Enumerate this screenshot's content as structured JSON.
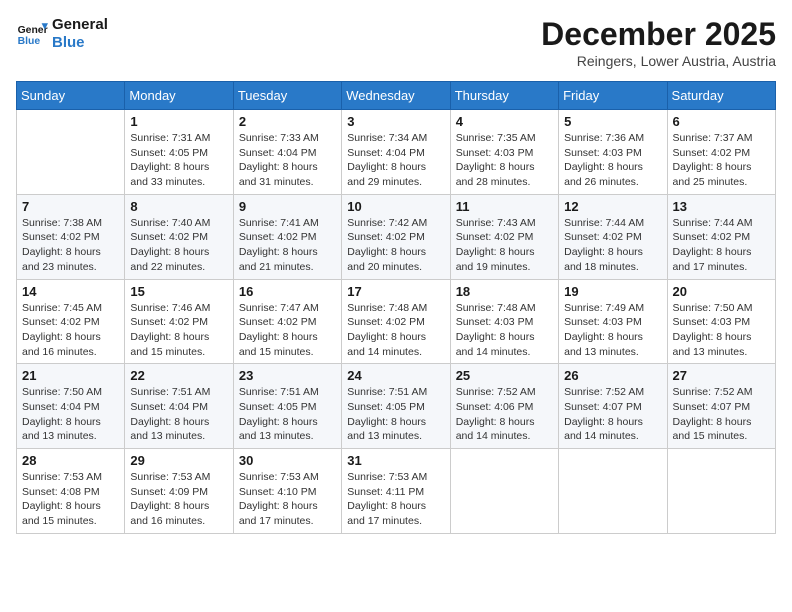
{
  "header": {
    "logo_line1": "General",
    "logo_line2": "Blue",
    "month_title": "December 2025",
    "subtitle": "Reingers, Lower Austria, Austria"
  },
  "weekdays": [
    "Sunday",
    "Monday",
    "Tuesday",
    "Wednesday",
    "Thursday",
    "Friday",
    "Saturday"
  ],
  "weeks": [
    [
      {
        "day": "",
        "info": ""
      },
      {
        "day": "1",
        "info": "Sunrise: 7:31 AM\nSunset: 4:05 PM\nDaylight: 8 hours\nand 33 minutes."
      },
      {
        "day": "2",
        "info": "Sunrise: 7:33 AM\nSunset: 4:04 PM\nDaylight: 8 hours\nand 31 minutes."
      },
      {
        "day": "3",
        "info": "Sunrise: 7:34 AM\nSunset: 4:04 PM\nDaylight: 8 hours\nand 29 minutes."
      },
      {
        "day": "4",
        "info": "Sunrise: 7:35 AM\nSunset: 4:03 PM\nDaylight: 8 hours\nand 28 minutes."
      },
      {
        "day": "5",
        "info": "Sunrise: 7:36 AM\nSunset: 4:03 PM\nDaylight: 8 hours\nand 26 minutes."
      },
      {
        "day": "6",
        "info": "Sunrise: 7:37 AM\nSunset: 4:02 PM\nDaylight: 8 hours\nand 25 minutes."
      }
    ],
    [
      {
        "day": "7",
        "info": "Sunrise: 7:38 AM\nSunset: 4:02 PM\nDaylight: 8 hours\nand 23 minutes."
      },
      {
        "day": "8",
        "info": "Sunrise: 7:40 AM\nSunset: 4:02 PM\nDaylight: 8 hours\nand 22 minutes."
      },
      {
        "day": "9",
        "info": "Sunrise: 7:41 AM\nSunset: 4:02 PM\nDaylight: 8 hours\nand 21 minutes."
      },
      {
        "day": "10",
        "info": "Sunrise: 7:42 AM\nSunset: 4:02 PM\nDaylight: 8 hours\nand 20 minutes."
      },
      {
        "day": "11",
        "info": "Sunrise: 7:43 AM\nSunset: 4:02 PM\nDaylight: 8 hours\nand 19 minutes."
      },
      {
        "day": "12",
        "info": "Sunrise: 7:44 AM\nSunset: 4:02 PM\nDaylight: 8 hours\nand 18 minutes."
      },
      {
        "day": "13",
        "info": "Sunrise: 7:44 AM\nSunset: 4:02 PM\nDaylight: 8 hours\nand 17 minutes."
      }
    ],
    [
      {
        "day": "14",
        "info": "Sunrise: 7:45 AM\nSunset: 4:02 PM\nDaylight: 8 hours\nand 16 minutes."
      },
      {
        "day": "15",
        "info": "Sunrise: 7:46 AM\nSunset: 4:02 PM\nDaylight: 8 hours\nand 15 minutes."
      },
      {
        "day": "16",
        "info": "Sunrise: 7:47 AM\nSunset: 4:02 PM\nDaylight: 8 hours\nand 15 minutes."
      },
      {
        "day": "17",
        "info": "Sunrise: 7:48 AM\nSunset: 4:02 PM\nDaylight: 8 hours\nand 14 minutes."
      },
      {
        "day": "18",
        "info": "Sunrise: 7:48 AM\nSunset: 4:03 PM\nDaylight: 8 hours\nand 14 minutes."
      },
      {
        "day": "19",
        "info": "Sunrise: 7:49 AM\nSunset: 4:03 PM\nDaylight: 8 hours\nand 13 minutes."
      },
      {
        "day": "20",
        "info": "Sunrise: 7:50 AM\nSunset: 4:03 PM\nDaylight: 8 hours\nand 13 minutes."
      }
    ],
    [
      {
        "day": "21",
        "info": "Sunrise: 7:50 AM\nSunset: 4:04 PM\nDaylight: 8 hours\nand 13 minutes."
      },
      {
        "day": "22",
        "info": "Sunrise: 7:51 AM\nSunset: 4:04 PM\nDaylight: 8 hours\nand 13 minutes."
      },
      {
        "day": "23",
        "info": "Sunrise: 7:51 AM\nSunset: 4:05 PM\nDaylight: 8 hours\nand 13 minutes."
      },
      {
        "day": "24",
        "info": "Sunrise: 7:51 AM\nSunset: 4:05 PM\nDaylight: 8 hours\nand 13 minutes."
      },
      {
        "day": "25",
        "info": "Sunrise: 7:52 AM\nSunset: 4:06 PM\nDaylight: 8 hours\nand 14 minutes."
      },
      {
        "day": "26",
        "info": "Sunrise: 7:52 AM\nSunset: 4:07 PM\nDaylight: 8 hours\nand 14 minutes."
      },
      {
        "day": "27",
        "info": "Sunrise: 7:52 AM\nSunset: 4:07 PM\nDaylight: 8 hours\nand 15 minutes."
      }
    ],
    [
      {
        "day": "28",
        "info": "Sunrise: 7:53 AM\nSunset: 4:08 PM\nDaylight: 8 hours\nand 15 minutes."
      },
      {
        "day": "29",
        "info": "Sunrise: 7:53 AM\nSunset: 4:09 PM\nDaylight: 8 hours\nand 16 minutes."
      },
      {
        "day": "30",
        "info": "Sunrise: 7:53 AM\nSunset: 4:10 PM\nDaylight: 8 hours\nand 17 minutes."
      },
      {
        "day": "31",
        "info": "Sunrise: 7:53 AM\nSunset: 4:11 PM\nDaylight: 8 hours\nand 17 minutes."
      },
      {
        "day": "",
        "info": ""
      },
      {
        "day": "",
        "info": ""
      },
      {
        "day": "",
        "info": ""
      }
    ]
  ]
}
